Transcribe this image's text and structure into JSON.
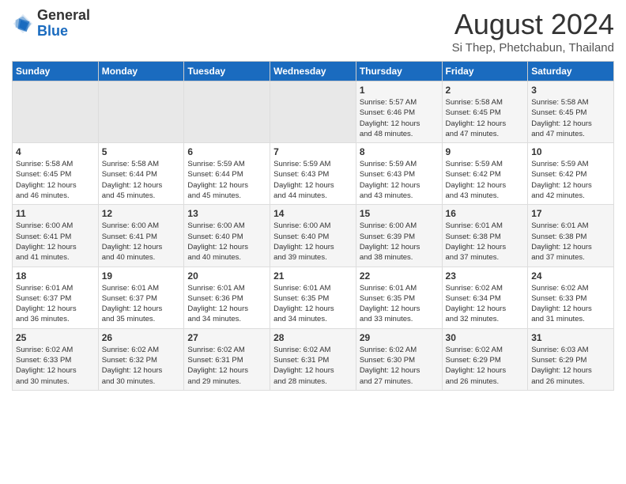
{
  "header": {
    "logo_general": "General",
    "logo_blue": "Blue",
    "month_title": "August 2024",
    "location": "Si Thep, Phetchabun, Thailand"
  },
  "calendar": {
    "days_of_week": [
      "Sunday",
      "Monday",
      "Tuesday",
      "Wednesday",
      "Thursday",
      "Friday",
      "Saturday"
    ],
    "weeks": [
      [
        {
          "day": "",
          "info": ""
        },
        {
          "day": "",
          "info": ""
        },
        {
          "day": "",
          "info": ""
        },
        {
          "day": "",
          "info": ""
        },
        {
          "day": "1",
          "info": "Sunrise: 5:57 AM\nSunset: 6:46 PM\nDaylight: 12 hours\nand 48 minutes."
        },
        {
          "day": "2",
          "info": "Sunrise: 5:58 AM\nSunset: 6:45 PM\nDaylight: 12 hours\nand 47 minutes."
        },
        {
          "day": "3",
          "info": "Sunrise: 5:58 AM\nSunset: 6:45 PM\nDaylight: 12 hours\nand 47 minutes."
        }
      ],
      [
        {
          "day": "4",
          "info": "Sunrise: 5:58 AM\nSunset: 6:45 PM\nDaylight: 12 hours\nand 46 minutes."
        },
        {
          "day": "5",
          "info": "Sunrise: 5:58 AM\nSunset: 6:44 PM\nDaylight: 12 hours\nand 45 minutes."
        },
        {
          "day": "6",
          "info": "Sunrise: 5:59 AM\nSunset: 6:44 PM\nDaylight: 12 hours\nand 45 minutes."
        },
        {
          "day": "7",
          "info": "Sunrise: 5:59 AM\nSunset: 6:43 PM\nDaylight: 12 hours\nand 44 minutes."
        },
        {
          "day": "8",
          "info": "Sunrise: 5:59 AM\nSunset: 6:43 PM\nDaylight: 12 hours\nand 43 minutes."
        },
        {
          "day": "9",
          "info": "Sunrise: 5:59 AM\nSunset: 6:42 PM\nDaylight: 12 hours\nand 43 minutes."
        },
        {
          "day": "10",
          "info": "Sunrise: 5:59 AM\nSunset: 6:42 PM\nDaylight: 12 hours\nand 42 minutes."
        }
      ],
      [
        {
          "day": "11",
          "info": "Sunrise: 6:00 AM\nSunset: 6:41 PM\nDaylight: 12 hours\nand 41 minutes."
        },
        {
          "day": "12",
          "info": "Sunrise: 6:00 AM\nSunset: 6:41 PM\nDaylight: 12 hours\nand 40 minutes."
        },
        {
          "day": "13",
          "info": "Sunrise: 6:00 AM\nSunset: 6:40 PM\nDaylight: 12 hours\nand 40 minutes."
        },
        {
          "day": "14",
          "info": "Sunrise: 6:00 AM\nSunset: 6:40 PM\nDaylight: 12 hours\nand 39 minutes."
        },
        {
          "day": "15",
          "info": "Sunrise: 6:00 AM\nSunset: 6:39 PM\nDaylight: 12 hours\nand 38 minutes."
        },
        {
          "day": "16",
          "info": "Sunrise: 6:01 AM\nSunset: 6:38 PM\nDaylight: 12 hours\nand 37 minutes."
        },
        {
          "day": "17",
          "info": "Sunrise: 6:01 AM\nSunset: 6:38 PM\nDaylight: 12 hours\nand 37 minutes."
        }
      ],
      [
        {
          "day": "18",
          "info": "Sunrise: 6:01 AM\nSunset: 6:37 PM\nDaylight: 12 hours\nand 36 minutes."
        },
        {
          "day": "19",
          "info": "Sunrise: 6:01 AM\nSunset: 6:37 PM\nDaylight: 12 hours\nand 35 minutes."
        },
        {
          "day": "20",
          "info": "Sunrise: 6:01 AM\nSunset: 6:36 PM\nDaylight: 12 hours\nand 34 minutes."
        },
        {
          "day": "21",
          "info": "Sunrise: 6:01 AM\nSunset: 6:35 PM\nDaylight: 12 hours\nand 34 minutes."
        },
        {
          "day": "22",
          "info": "Sunrise: 6:01 AM\nSunset: 6:35 PM\nDaylight: 12 hours\nand 33 minutes."
        },
        {
          "day": "23",
          "info": "Sunrise: 6:02 AM\nSunset: 6:34 PM\nDaylight: 12 hours\nand 32 minutes."
        },
        {
          "day": "24",
          "info": "Sunrise: 6:02 AM\nSunset: 6:33 PM\nDaylight: 12 hours\nand 31 minutes."
        }
      ],
      [
        {
          "day": "25",
          "info": "Sunrise: 6:02 AM\nSunset: 6:33 PM\nDaylight: 12 hours\nand 30 minutes."
        },
        {
          "day": "26",
          "info": "Sunrise: 6:02 AM\nSunset: 6:32 PM\nDaylight: 12 hours\nand 30 minutes."
        },
        {
          "day": "27",
          "info": "Sunrise: 6:02 AM\nSunset: 6:31 PM\nDaylight: 12 hours\nand 29 minutes."
        },
        {
          "day": "28",
          "info": "Sunrise: 6:02 AM\nSunset: 6:31 PM\nDaylight: 12 hours\nand 28 minutes."
        },
        {
          "day": "29",
          "info": "Sunrise: 6:02 AM\nSunset: 6:30 PM\nDaylight: 12 hours\nand 27 minutes."
        },
        {
          "day": "30",
          "info": "Sunrise: 6:02 AM\nSunset: 6:29 PM\nDaylight: 12 hours\nand 26 minutes."
        },
        {
          "day": "31",
          "info": "Sunrise: 6:03 AM\nSunset: 6:29 PM\nDaylight: 12 hours\nand 26 minutes."
        }
      ]
    ]
  }
}
